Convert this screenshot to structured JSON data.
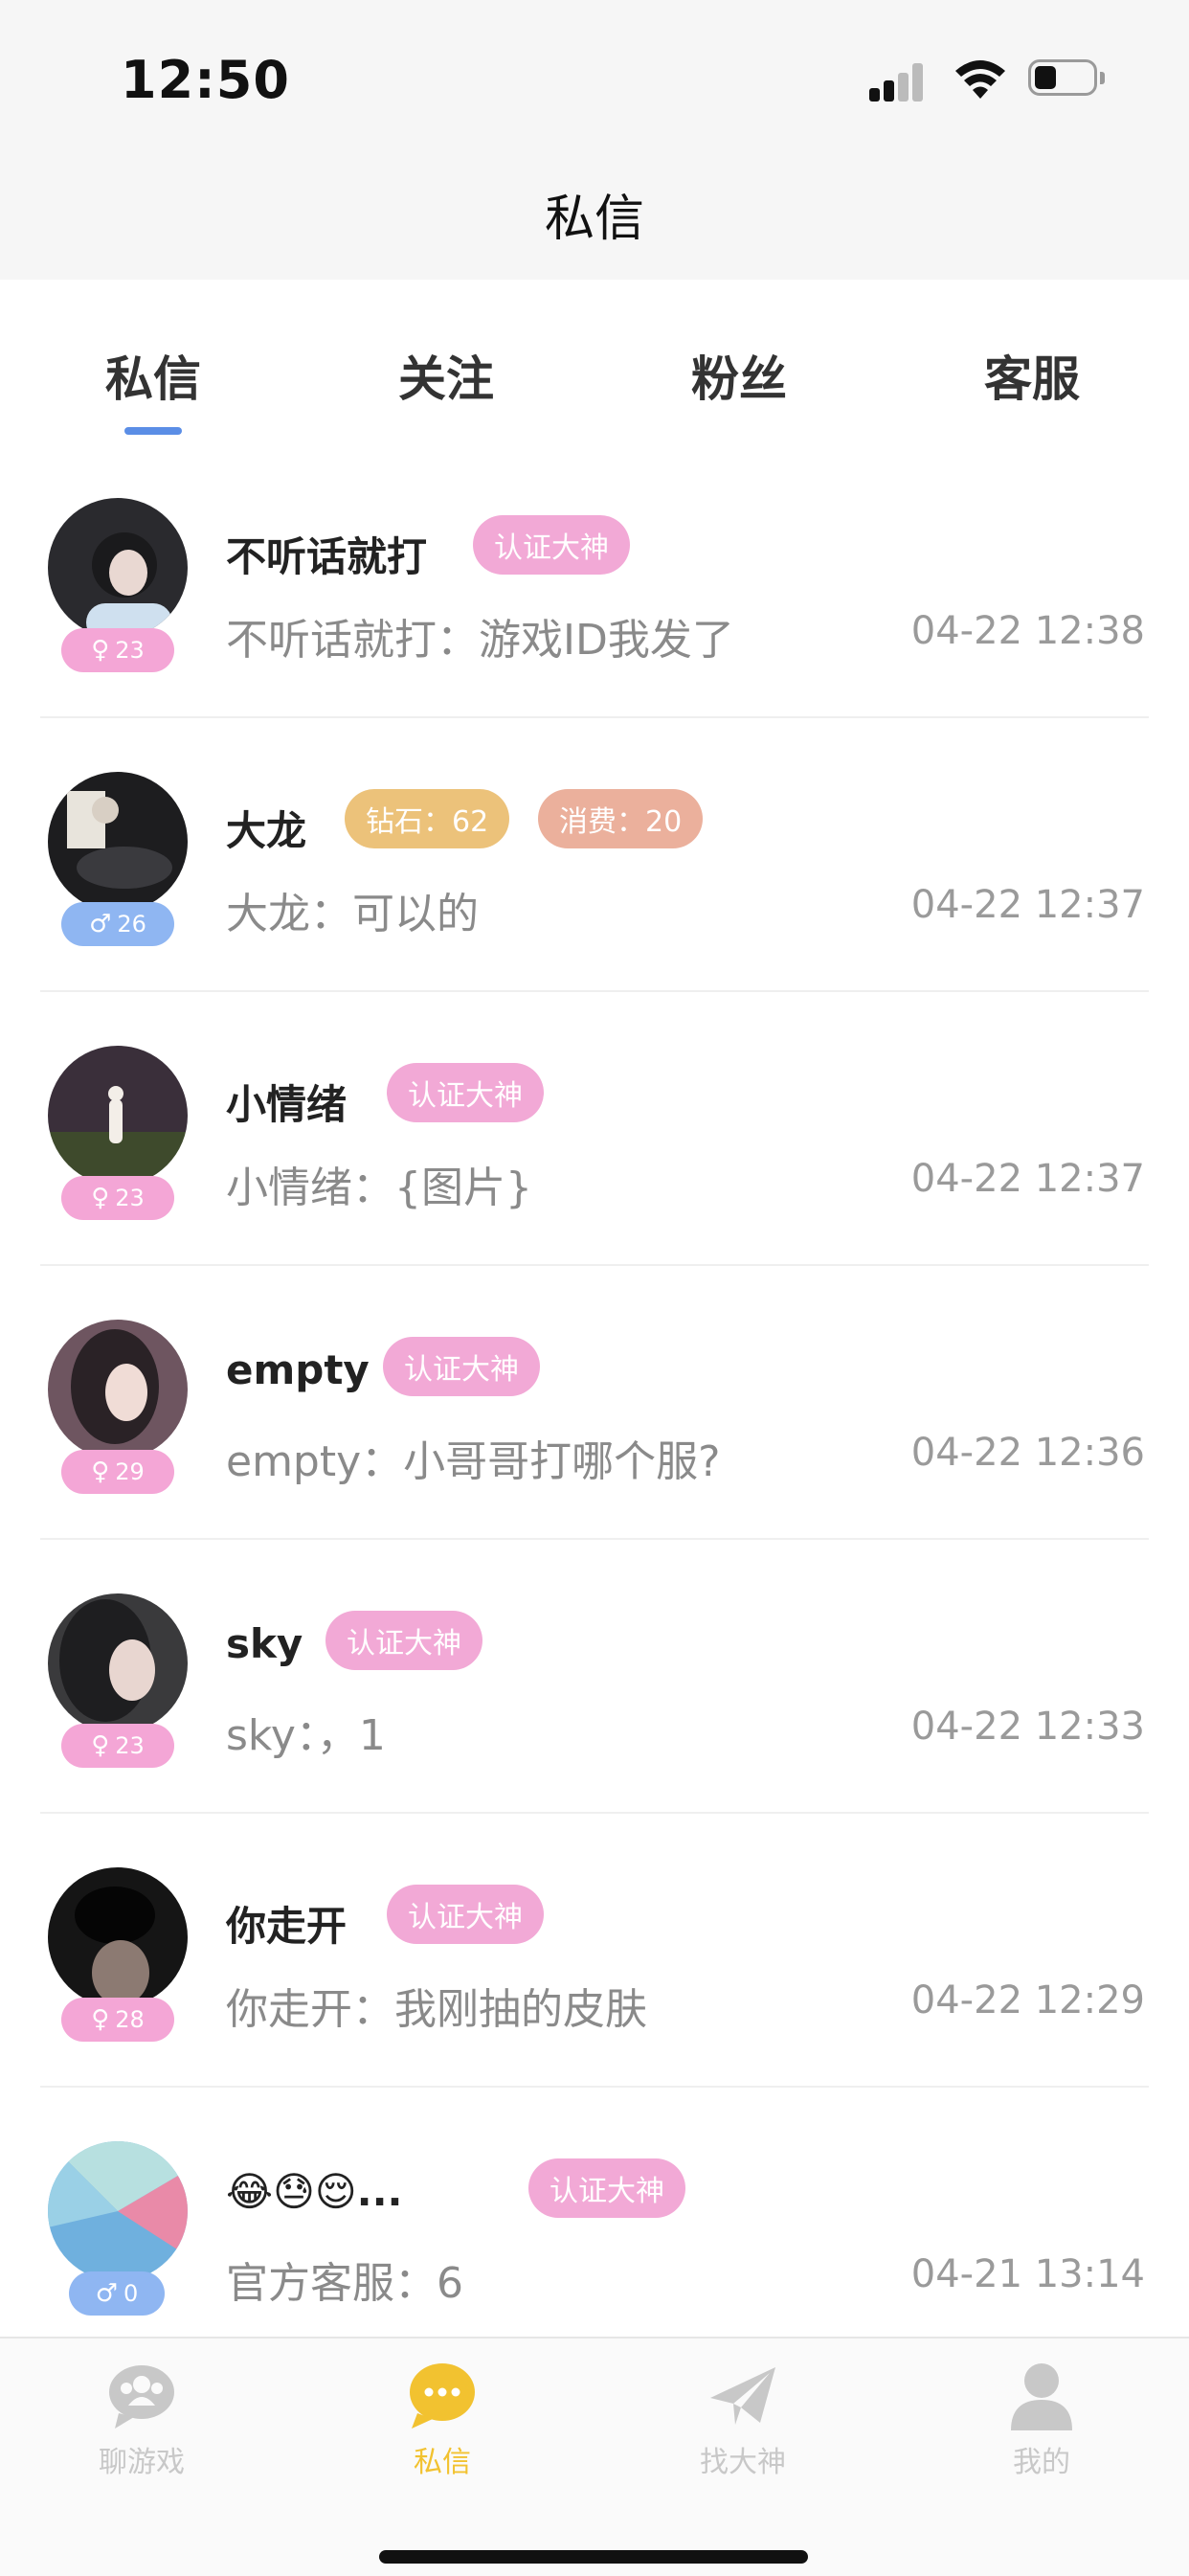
{
  "status_bar": {
    "time": "12:50"
  },
  "header": {
    "title": "私信"
  },
  "tabs": [
    {
      "label": "私信",
      "active": true
    },
    {
      "label": "关注",
      "active": false
    },
    {
      "label": "粉丝",
      "active": false
    },
    {
      "label": "客服",
      "active": false
    }
  ],
  "conversations": [
    {
      "name": "不听话就打",
      "age": "23",
      "gender": "female",
      "tags": [
        "认证大神"
      ],
      "preview": "不听话就打：游戏ID我发了",
      "time": "04-22 12:38"
    },
    {
      "name": "大龙",
      "age": "26",
      "gender": "male",
      "tags": [
        "钻石：62",
        "消费：20"
      ],
      "preview": "大龙：可以的",
      "time": "04-22 12:37"
    },
    {
      "name": "小情绪",
      "age": "23",
      "gender": "female",
      "tags": [
        "认证大神"
      ],
      "preview": "小情绪：{图片}",
      "time": "04-22 12:37"
    },
    {
      "name": "empty",
      "age": "29",
      "gender": "female",
      "tags": [
        "认证大神"
      ],
      "preview": "empty：小哥哥打哪个服?",
      "time": "04-22 12:36"
    },
    {
      "name": "sky",
      "age": "23",
      "gender": "female",
      "tags": [
        "认证大神"
      ],
      "preview": "sky：，1",
      "time": "04-22 12:33"
    },
    {
      "name": "你走开",
      "age": "28",
      "gender": "female",
      "tags": [
        "认证大神"
      ],
      "preview": "你走开：我刚抽的皮肤",
      "time": "04-22 12:29"
    },
    {
      "name": "😂😓😌...",
      "age": "0",
      "gender": "male",
      "tags": [
        "认证大神"
      ],
      "preview": "官方客服：6",
      "time": "04-21 13:14"
    }
  ],
  "bottom_nav": [
    {
      "label": "聊游戏",
      "icon": "chat-group-icon",
      "active": false
    },
    {
      "label": "私信",
      "icon": "message-bubble-icon",
      "active": true
    },
    {
      "label": "找大神",
      "icon": "paper-plane-icon",
      "active": false
    },
    {
      "label": "我的",
      "icon": "person-icon",
      "active": false
    }
  ],
  "colors": {
    "tag_certified": "#f2a9d6",
    "tag_diamond": "#ecc27a",
    "tag_spend": "#ebb09c",
    "female_badge": "#f4a6d6",
    "male_badge": "#8fb6f2",
    "tab_underline": "#5b8ee6",
    "nav_active": "#f2c230",
    "nav_inactive": "#c8c8c8"
  }
}
